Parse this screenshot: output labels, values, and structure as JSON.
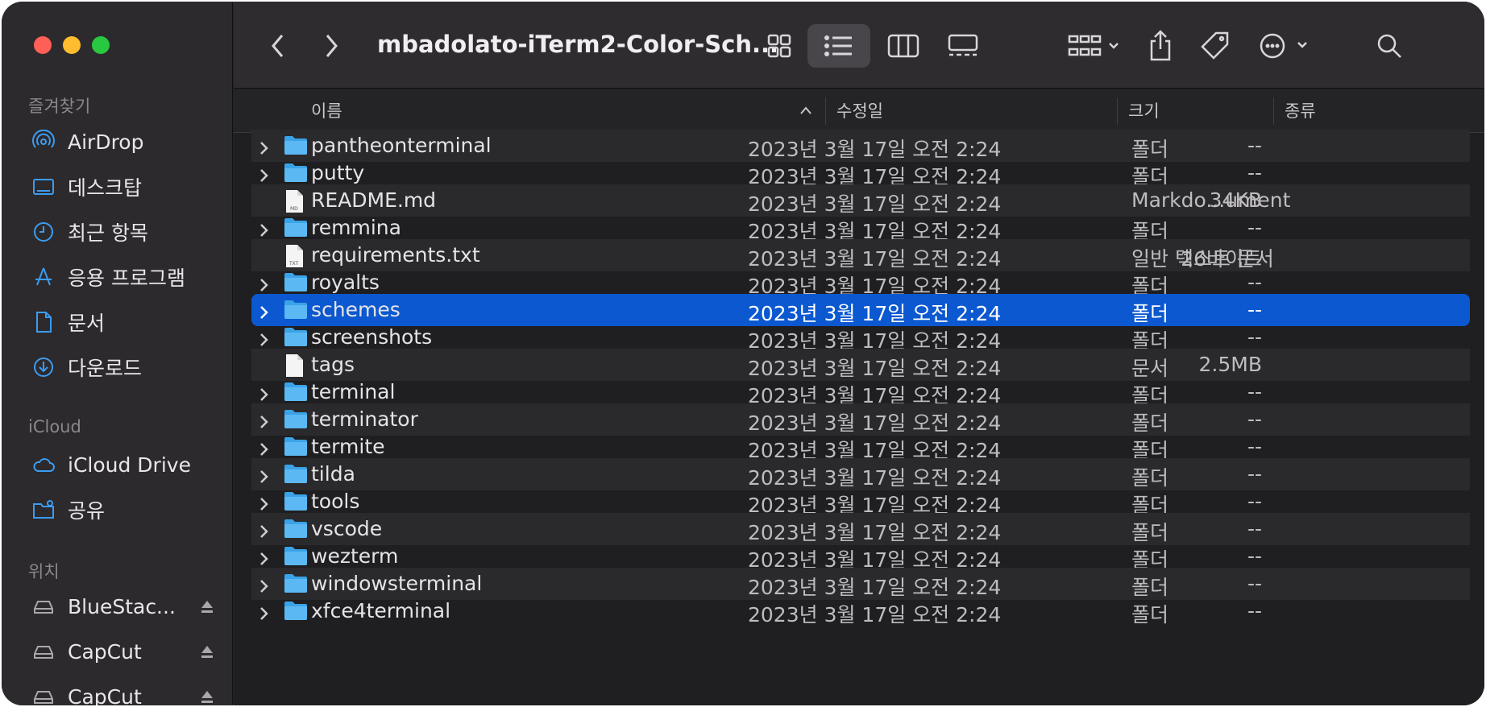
{
  "window": {
    "title": "mbadolato-iTerm2-Color-Sch..."
  },
  "colors": {
    "accent": "#0b58d0",
    "folder": "#3aa3e8",
    "sidebar_icon": "#3b9cf2"
  },
  "sidebar": {
    "favorites_title": "즐겨찾기",
    "favorites": [
      {
        "label": "AirDrop",
        "icon": "airdrop-icon"
      },
      {
        "label": "데스크탑",
        "icon": "desktop-icon"
      },
      {
        "label": "최근 항목",
        "icon": "clock-icon"
      },
      {
        "label": "응용 프로그램",
        "icon": "applications-icon"
      },
      {
        "label": "문서",
        "icon": "document-icon"
      },
      {
        "label": "다운로드",
        "icon": "download-icon"
      }
    ],
    "icloud_title": "iCloud",
    "icloud": [
      {
        "label": "iCloud Drive",
        "icon": "cloud-icon"
      },
      {
        "label": "공유",
        "icon": "shared-folder-icon"
      }
    ],
    "locations_title": "위치",
    "locations": [
      {
        "label": "BlueStac...",
        "icon": "disk-icon"
      },
      {
        "label": "CapCut",
        "icon": "disk-icon"
      },
      {
        "label": "CapCut",
        "icon": "disk-icon"
      }
    ]
  },
  "columns": {
    "name": "이름",
    "modified": "수정일",
    "size": "크기",
    "kind": "종류"
  },
  "files": [
    {
      "name": "pantheonterminal",
      "date": "2023년 3월 17일 오전 2:24",
      "size": "--",
      "kind": "폴더",
      "type": "folder"
    },
    {
      "name": "putty",
      "date": "2023년 3월 17일 오전 2:24",
      "size": "--",
      "kind": "폴더",
      "type": "folder"
    },
    {
      "name": "README.md",
      "date": "2023년 3월 17일 오전 2:24",
      "size": "34KB",
      "kind": "Markdo...ument",
      "type": "md"
    },
    {
      "name": "remmina",
      "date": "2023년 3월 17일 오전 2:24",
      "size": "--",
      "kind": "폴더",
      "type": "folder"
    },
    {
      "name": "requirements.txt",
      "date": "2023년 3월 17일 오전 2:24",
      "size": "26바이트",
      "kind": "일반 텍스트 문서",
      "type": "txt"
    },
    {
      "name": "royalts",
      "date": "2023년 3월 17일 오전 2:24",
      "size": "--",
      "kind": "폴더",
      "type": "folder"
    },
    {
      "name": "schemes",
      "date": "2023년 3월 17일 오전 2:24",
      "size": "--",
      "kind": "폴더",
      "type": "folder",
      "selected": true
    },
    {
      "name": "screenshots",
      "date": "2023년 3월 17일 오전 2:24",
      "size": "--",
      "kind": "폴더",
      "type": "folder"
    },
    {
      "name": "tags",
      "date": "2023년 3월 17일 오전 2:24",
      "size": "2.5MB",
      "kind": "문서",
      "type": "file"
    },
    {
      "name": "terminal",
      "date": "2023년 3월 17일 오전 2:24",
      "size": "--",
      "kind": "폴더",
      "type": "folder"
    },
    {
      "name": "terminator",
      "date": "2023년 3월 17일 오전 2:24",
      "size": "--",
      "kind": "폴더",
      "type": "folder"
    },
    {
      "name": "termite",
      "date": "2023년 3월 17일 오전 2:24",
      "size": "--",
      "kind": "폴더",
      "type": "folder"
    },
    {
      "name": "tilda",
      "date": "2023년 3월 17일 오전 2:24",
      "size": "--",
      "kind": "폴더",
      "type": "folder"
    },
    {
      "name": "tools",
      "date": "2023년 3월 17일 오전 2:24",
      "size": "--",
      "kind": "폴더",
      "type": "folder"
    },
    {
      "name": "vscode",
      "date": "2023년 3월 17일 오전 2:24",
      "size": "--",
      "kind": "폴더",
      "type": "folder"
    },
    {
      "name": "wezterm",
      "date": "2023년 3월 17일 오전 2:24",
      "size": "--",
      "kind": "폴더",
      "type": "folder"
    },
    {
      "name": "windowsterminal",
      "date": "2023년 3월 17일 오전 2:24",
      "size": "--",
      "kind": "폴더",
      "type": "folder"
    },
    {
      "name": "xfce4terminal",
      "date": "2023년 3월 17일 오전 2:24",
      "size": "--",
      "kind": "폴더",
      "type": "folder"
    }
  ]
}
